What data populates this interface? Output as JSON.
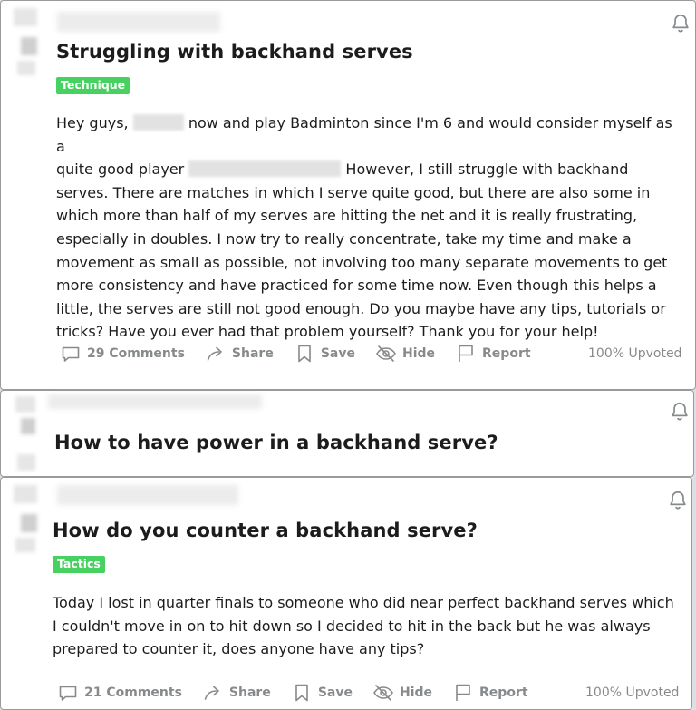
{
  "posts": [
    {
      "title": "Struggling with backhand serves",
      "flair": "Technique",
      "body": {
        "l1a": "Hey guys,",
        "l1b": "now and play Badminton since I'm 6 and would consider myself as a",
        "l2a": "quite good player",
        "l2b": "However, I still struggle with backhand",
        "l3": "serves. There are matches in which I serve quite good, but there are also some in",
        "l4": "which more than half of my serves are hitting the net and it is really frustrating,",
        "l5": "especially in doubles. I now try to really concentrate, take my time and make a",
        "l6": "movement as small as possible, not involving too many separate movements to get",
        "l7": "more consistency and have practiced for some time now. Even though this helps a",
        "l8": "little, the serves are still not good enough. Do you maybe have any tips, tutorials or",
        "l9": "tricks? Have you ever had that problem yourself? Thank you for your help!"
      },
      "actions": {
        "comments": "29 Comments",
        "share": "Share",
        "save": "Save",
        "hide": "Hide",
        "report": "Report"
      },
      "upvoted": "100% Upvoted"
    },
    {
      "title": "How to have power in a backhand serve?"
    },
    {
      "title": "How do you counter a backhand serve?",
      "flair": "Tactics",
      "body": {
        "l1": "Today I lost in quarter finals to someone who did near perfect backhand serves which",
        "l2": "I couldn't move in on to hit down so I decided to hit in the back but he was always",
        "l3": "prepared to counter it, does anyone have any tips?"
      },
      "actions": {
        "comments": "21 Comments",
        "share": "Share",
        "save": "Save",
        "hide": "Hide",
        "report": "Report"
      },
      "upvoted": "100% Upvoted"
    }
  ],
  "colors": {
    "flair": "#46d160",
    "meta_text": "#878a8c",
    "title_text": "#1c1c1c"
  },
  "icons": [
    "bell-icon",
    "comment-icon",
    "share-icon",
    "save-icon",
    "hide-icon",
    "report-icon"
  ]
}
